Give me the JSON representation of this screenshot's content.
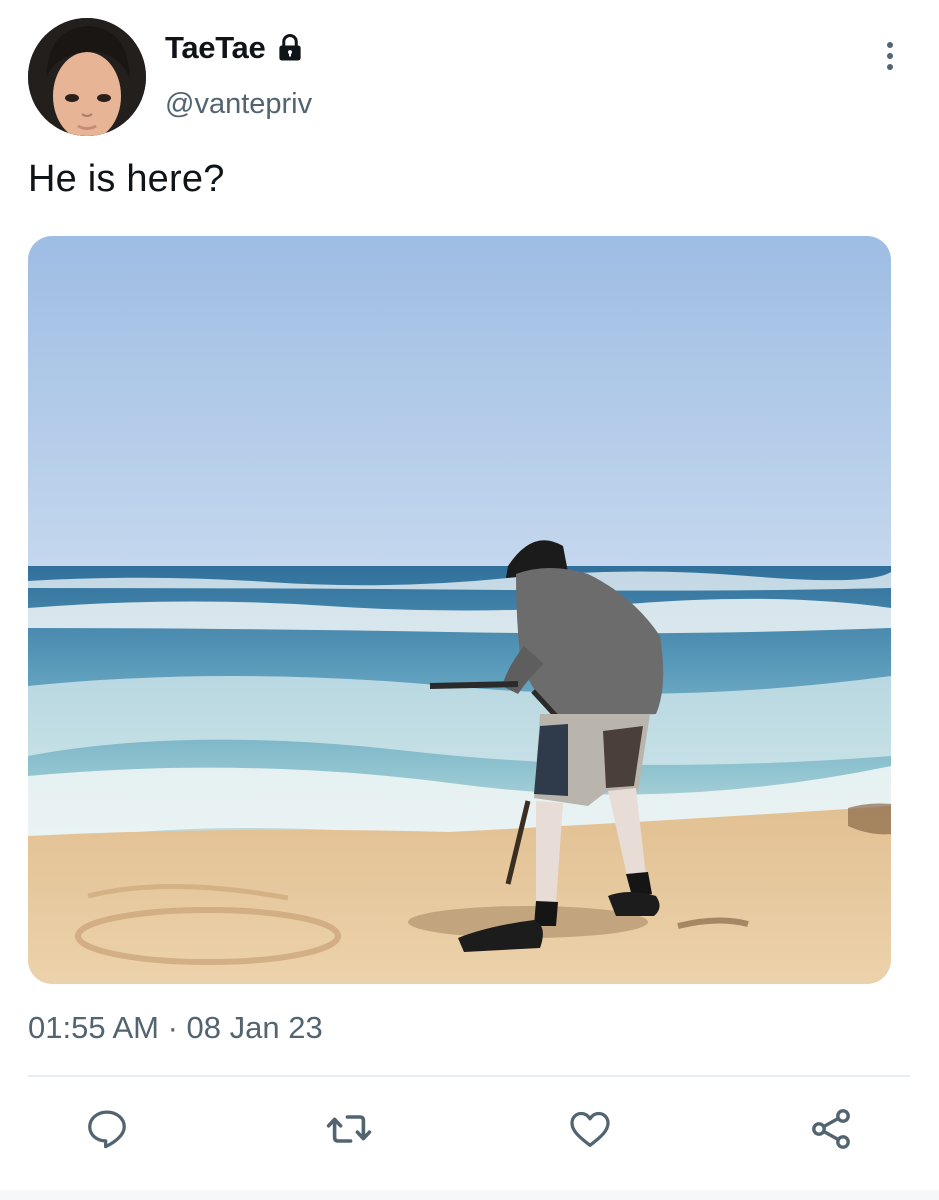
{
  "user": {
    "display_name": "TaeTae",
    "handle": "@vantepriv",
    "protected": true,
    "avatar_icon": "profile-photo"
  },
  "tweet": {
    "text": "He is here?",
    "timestamp": "01:55 AM · 08 Jan 23",
    "media_alt": "Person in a bucket hat and grey sweatshirt drawing in the sand with a stick on a beach"
  },
  "actions": [
    {
      "name": "reply",
      "icon": "reply-icon"
    },
    {
      "name": "retweet",
      "icon": "retweet-icon"
    },
    {
      "name": "like",
      "icon": "heart-icon"
    },
    {
      "name": "share",
      "icon": "share-icon"
    }
  ],
  "colors": {
    "text_primary": "#0f1419",
    "text_secondary": "#536471",
    "divider": "#e6ecf0",
    "sky": "#a9c6e6",
    "sea": "#4f8fb4",
    "sand": "#e6c79e"
  }
}
